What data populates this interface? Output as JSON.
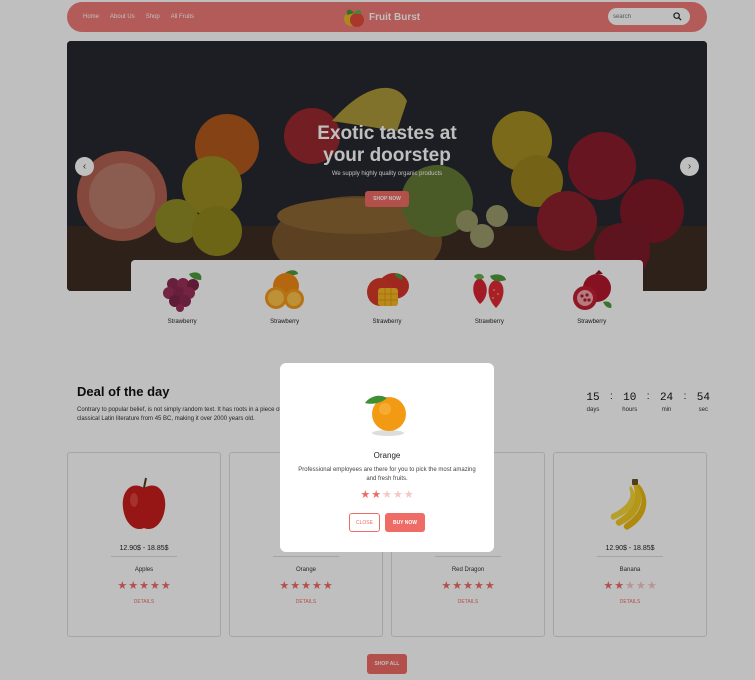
{
  "nav": {
    "links": [
      "Home",
      "About Us",
      "Shop",
      "All Fruits"
    ],
    "brand": "Fruit Burst",
    "search_placeholder": "search"
  },
  "hero": {
    "title_line1": "Exotic tastes at",
    "title_line2": "your doorstep",
    "subtitle": "We supply highly quality organic products",
    "button": "SHOP NOW",
    "prev": "‹",
    "next": "›"
  },
  "categories": [
    {
      "label": "Strawberry",
      "icon": "grapes-icon"
    },
    {
      "label": "Strawberry",
      "icon": "orange-icon"
    },
    {
      "label": "Strawberry",
      "icon": "mango-icon"
    },
    {
      "label": "Strawberry",
      "icon": "strawberry-icon"
    },
    {
      "label": "Strawberry",
      "icon": "pomegranate-icon"
    }
  ],
  "deal": {
    "title": "Deal of the day",
    "text": "Contrary to popular belief, is not simply random text. It has roots in a piece of classical Latin literature from 45 BC, making it over 2000 years old.",
    "countdown": [
      {
        "value": "15",
        "label": "days"
      },
      {
        "value": "10",
        "label": "hours"
      },
      {
        "value": "24",
        "label": "min"
      },
      {
        "value": "54",
        "label": "sec"
      }
    ],
    "separator": ":"
  },
  "products": [
    {
      "price": "12.90$ - 18.85$",
      "name": "Apples",
      "rating": 5,
      "details": "DETAILS",
      "icon": "apple-icon"
    },
    {
      "price": "12.90$ - 18.85$",
      "name": "Orange",
      "rating": 5,
      "details": "DETAILS",
      "icon": "orange-icon"
    },
    {
      "price": "12.90$ - 18.85$",
      "name": "Red Dragon",
      "rating": 5,
      "details": "DETAILS",
      "icon": "dragon-fruit-icon"
    },
    {
      "price": "12.90$ - 18.85$",
      "name": "Banana",
      "rating": 2,
      "details": "DETAILS",
      "icon": "banana-icon"
    }
  ],
  "shop_all": "SHOP ALL",
  "modal": {
    "title": "Orange",
    "description": "Professional employees are there for you to pick the most amazing and fresh fruits.",
    "rating": 2,
    "close": "CLOSE",
    "buy": "BUY NOW"
  },
  "colors": {
    "accent": "#ef6b66",
    "nav": "#ef7a76",
    "star_off": "#f6c7c5"
  },
  "star_glyph": "★"
}
